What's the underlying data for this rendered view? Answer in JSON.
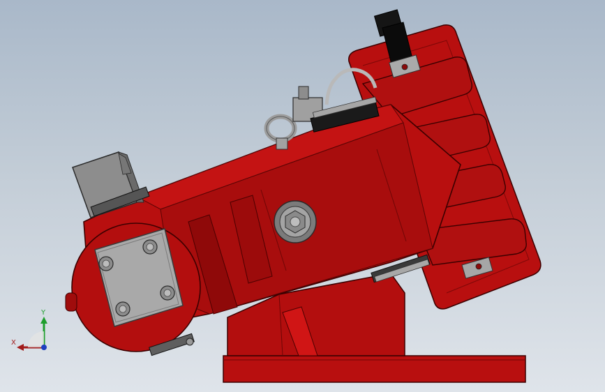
{
  "viewport": {
    "colors": {
      "background_top": "#a9b8c9",
      "background_bottom": "#dfe4ea",
      "part_red": "#b80f0f",
      "part_red_dark": "#8a0a0a",
      "part_red_light": "#d11818",
      "steel": "#9a9a9a",
      "steel_dark": "#5c5c5c",
      "black": "#111111"
    }
  },
  "triad": {
    "x_label": "X",
    "y_label": "Y",
    "x_color": "#a11a1a",
    "y_color": "#1e9e2c",
    "z_color": "#1f3fbf"
  }
}
